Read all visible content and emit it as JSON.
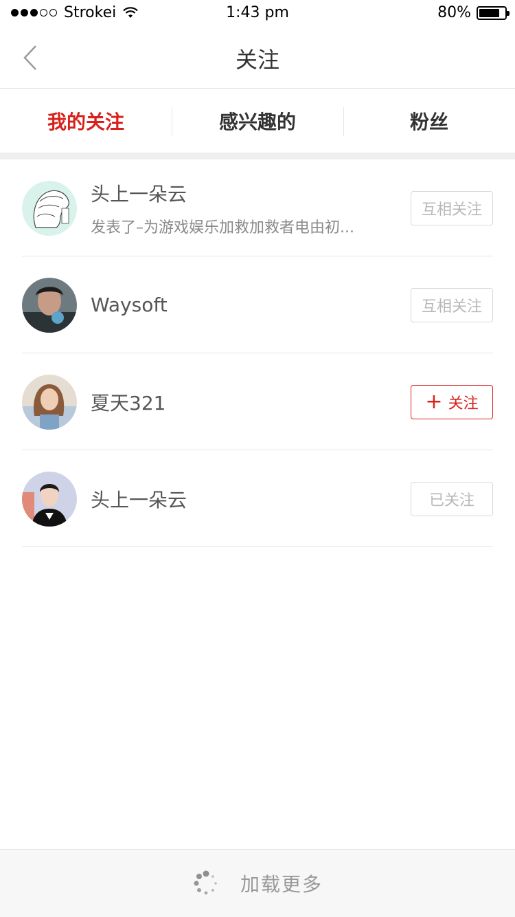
{
  "status_bar": {
    "carrier": "Strokei",
    "time": "1:43 pm",
    "battery": "80%",
    "battery_level": 0.8
  },
  "nav": {
    "title": "关注",
    "back_icon": "chevron-left-icon"
  },
  "tabs": [
    {
      "label": "我的关注",
      "active": true
    },
    {
      "label": "感兴趣的",
      "active": false
    },
    {
      "label": "粉丝",
      "active": false
    }
  ],
  "list": [
    {
      "name": "头上一朵云",
      "desc": "发表了–为游戏娱乐加救加救者电由初...",
      "button": "互相关注",
      "button_style": "muted"
    },
    {
      "name": "Waysoft",
      "desc": "",
      "button": "互相关注",
      "button_style": "muted"
    },
    {
      "name": "夏天321",
      "desc": "",
      "button": "关注",
      "button_style": "primary",
      "button_icon": "plus-icon"
    },
    {
      "name": "头上一朵云",
      "desc": "",
      "button": "已关注",
      "button_style": "muted"
    }
  ],
  "footer": {
    "load_more": "加载更多",
    "icon": "spinner-icon"
  },
  "colors": {
    "accent": "#d8211c",
    "muted_button_text": "#b8b8b8",
    "divider": "#e3e3e3"
  }
}
